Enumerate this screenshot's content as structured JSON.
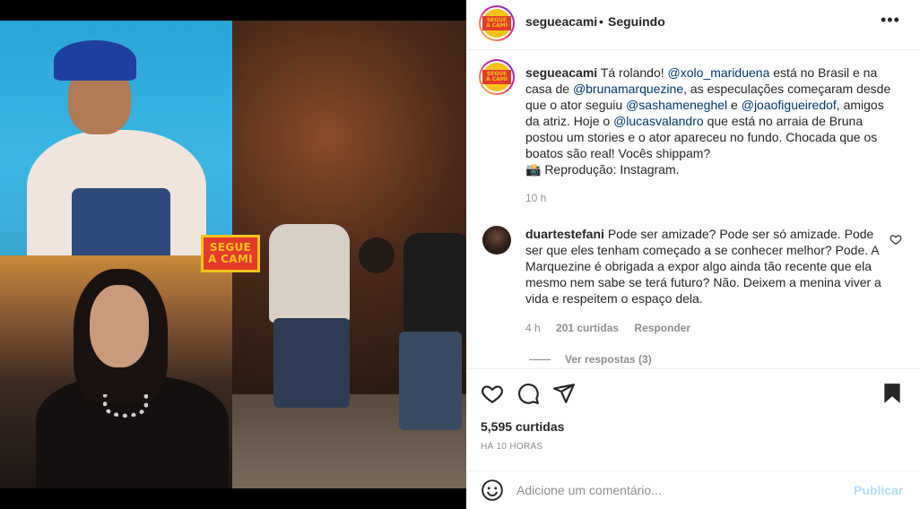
{
  "media": {
    "badge_line1": "SEGUE",
    "badge_line2": "A CAMI"
  },
  "header": {
    "username": "segueacami",
    "dot": "•",
    "follow_status": "Seguindo",
    "more": "•••",
    "avatar_text": "SEGUE A CAMI"
  },
  "caption": {
    "username": "segueacami",
    "text_1": "Tá rolando!",
    "mention_1": "@xolo_mariduena",
    "text_2": "está no Brasil e na casa de",
    "mention_2": "@brunamarquezine",
    "text_3": ", as especulações começaram desde que o ator seguiu",
    "mention_3": "@sashameneghel",
    "text_4": "e",
    "mention_4": "@joaofigueiredof",
    "text_5": ", amigos da atriz. Hoje o",
    "mention_5": "@lucasvalandro",
    "text_6": "que está no arraia de Bruna postou um stories e o ator apareceu no fundo. Chocada que os boatos são real! Vocês shippam?",
    "text_7": "📸 Reprodução: Instagram.",
    "time": "10 h"
  },
  "comment": {
    "username": "duartestefani",
    "text": "Pode ser amizade? Pode ser só amizade. Pode ser que eles tenham começado a se conhecer melhor? Pode. A Marquezine é obrigada a expor algo ainda tão recente que ela mesmo nem sabe se terá futuro? Não. Deixem a menina viver a vida e respeitem o espaço dela.",
    "time": "4 h",
    "likes": "201 curtidas",
    "reply": "Responder",
    "view_replies": "Ver respostas (3)"
  },
  "footer": {
    "likes": "5,595 curtidas",
    "ago": "HÁ 10 HORAS",
    "placeholder": "Adicione um comentário...",
    "publish": "Publicar"
  }
}
